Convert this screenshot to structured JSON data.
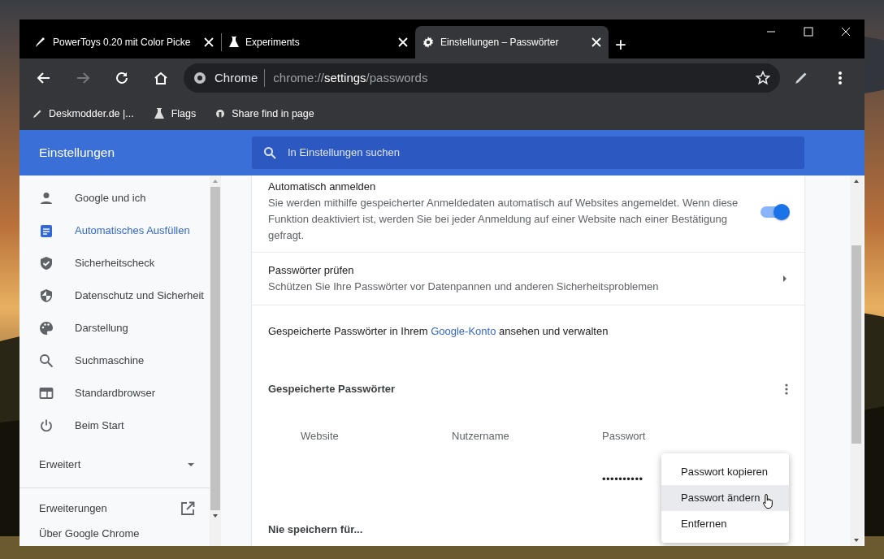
{
  "tabs": [
    {
      "title": "PowerToys 0.20 mit Color Picke",
      "selected": false
    },
    {
      "title": "Experiments",
      "selected": false
    },
    {
      "title": "Einstellungen – Passwörter",
      "selected": true
    }
  ],
  "new_tab": "+",
  "toolbar": {
    "forward_disabled": true,
    "omnibox": {
      "chip": "Chrome",
      "url": [
        {
          "text": "chrome://",
          "emphasized": false
        },
        {
          "text": "settings",
          "emphasized": true
        },
        {
          "text": "/passwords",
          "emphasized": false
        }
      ]
    }
  },
  "bookmarks": [
    "Deskmodder.de |...",
    "Flags",
    "Share find in page"
  ],
  "header": {
    "title": "Einstellungen",
    "search_placeholder": "In Einstellungen suchen"
  },
  "sidebar": {
    "items": [
      {
        "label": "Google und ich",
        "selected": false
      },
      {
        "label": "Automatisches Ausfüllen",
        "selected": true
      },
      {
        "label": "Sicherheitscheck",
        "selected": false
      },
      {
        "label": "Datenschutz und Sicherheit",
        "selected": false
      },
      {
        "label": "Darstellung",
        "selected": false
      },
      {
        "label": "Suchmaschine",
        "selected": false
      },
      {
        "label": "Standardbrowser",
        "selected": false
      },
      {
        "label": "Beim Start",
        "selected": false
      }
    ],
    "advanced": {
      "label": "Erweitert",
      "expanded": false
    },
    "extensions": "Erweiterungen",
    "about": "Über Google Chrome"
  },
  "settings": {
    "auto_signin": {
      "title": "Automatisch anmelden",
      "description": "Sie werden mithilfe gespeicherter Anmeldedaten automatisch auf Websites angemeldet. Wenn diese Funktion deaktiviert ist, werden Sie bei jeder Anmeldung auf einer Website nach einer Bestätigung gefragt.",
      "on": true
    },
    "check": {
      "title": "Passwörter prüfen",
      "description": "Schützen Sie Ihre Passwörter vor Datenpannen und anderen Sicherheitsproblemen"
    },
    "account_line": {
      "before": "Gespeicherte Passwörter in Ihrem ",
      "link": "Google-Konto",
      "after": " ansehen und verwalten"
    },
    "saved": {
      "title": "Gespeicherte Passwörter",
      "columns": [
        "Website",
        "Nutzername",
        "Passwort"
      ],
      "rows": [
        {
          "password": "••••••••••"
        }
      ]
    },
    "never_saved": "Nie speichern für..."
  },
  "menu": {
    "items": [
      {
        "label": "Passwort kopieren",
        "selected": false
      },
      {
        "label": "Passwort ändern",
        "selected": true
      },
      {
        "label": "Entfernen",
        "selected": false
      }
    ]
  }
}
